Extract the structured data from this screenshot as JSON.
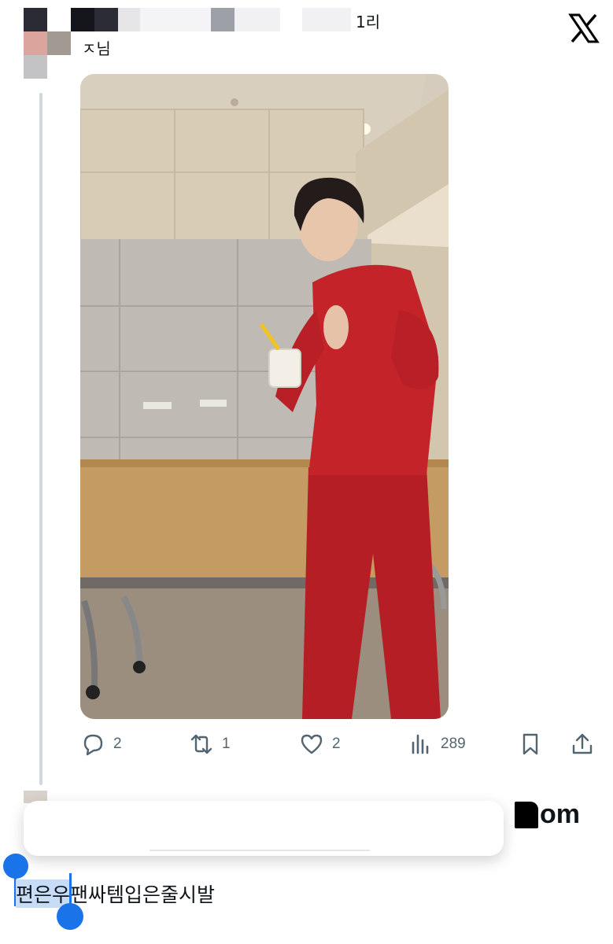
{
  "header": {
    "partial_text_right": "1리",
    "partial_text_left": "ㅈ님"
  },
  "brand": {
    "logo_icon": "x-logo-icon"
  },
  "media": {
    "alt": "photo"
  },
  "actions": {
    "reply_count": "2",
    "repost_count": "1",
    "like_count": "2",
    "view_count": "289"
  },
  "bottom": {
    "domain_suffix": "om"
  },
  "text": {
    "selected": "편은우",
    "rest": " 팬싸템입은줄시발"
  },
  "colors": {
    "accent": "#1a73e8",
    "icon_gray": "#536471",
    "selection": "#c7dcf6",
    "thread_line": "#cfd9de"
  }
}
